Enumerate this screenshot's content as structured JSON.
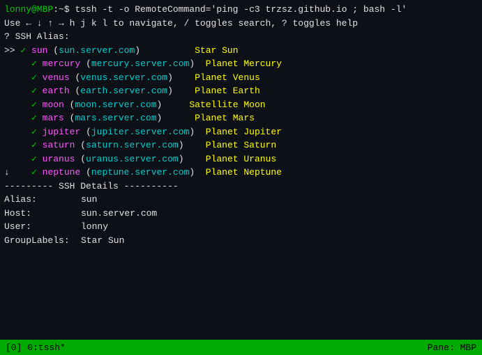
{
  "terminal": {
    "prompt": "lonny@MBP:~$ tssh -t -o RemoteCommand='ping -c3 trzsz.github.io ; bash -l'",
    "nav_hint": "Use ← ↓ ↑ → h j k l to navigate, / toggles search, ? toggles help",
    "ssh_alias_label": "? SSH Alias:",
    "entries": [
      {
        "selected": true,
        "arrow": ">>",
        "check": "✓",
        "alias": "sun",
        "host": "sun.server.com",
        "label": "Star Sun",
        "indent": 0,
        "is_arrow": true
      },
      {
        "selected": false,
        "arrow": "",
        "check": "✓",
        "alias": "mercury",
        "host": "mercury.server.com",
        "label": "Planet Mercury",
        "indent": 1,
        "is_arrow": false
      },
      {
        "selected": false,
        "arrow": "",
        "check": "✓",
        "alias": "venus",
        "host": "venus.server.com",
        "label": "Planet Venus",
        "indent": 1,
        "is_arrow": false
      },
      {
        "selected": false,
        "arrow": "",
        "check": "✓",
        "alias": "earth",
        "host": "earth.server.com",
        "label": "Planet Earth",
        "indent": 1,
        "is_arrow": false
      },
      {
        "selected": false,
        "arrow": "",
        "check": "✓",
        "alias": "moon",
        "host": "moon.server.com",
        "label": "Satellite Moon",
        "indent": 1,
        "is_arrow": false
      },
      {
        "selected": false,
        "arrow": "",
        "check": "✓",
        "alias": "mars",
        "host": "mars.server.com",
        "label": "Planet Mars",
        "indent": 1,
        "is_arrow": false
      },
      {
        "selected": false,
        "arrow": "",
        "check": "✓",
        "alias": "jupiter",
        "host": "jupiter.server.com",
        "label": "Planet Jupiter",
        "indent": 1,
        "is_arrow": false
      },
      {
        "selected": false,
        "arrow": "",
        "check": "✓",
        "alias": "saturn",
        "host": "saturn.server.com",
        "label": "Planet Saturn",
        "indent": 1,
        "is_arrow": false
      },
      {
        "selected": false,
        "arrow": "",
        "check": "✓",
        "alias": "uranus",
        "host": "uranus.server.com",
        "label": "Planet Uranus",
        "indent": 1,
        "is_arrow": false
      },
      {
        "selected": false,
        "arrow": "",
        "check": "✓",
        "alias": "neptune",
        "host": "neptune.server.com",
        "label": "Planet Neptune",
        "indent": 1,
        "is_arrow": false,
        "down_arrow": true
      }
    ],
    "details_separator": "--------- SSH Details ----------",
    "details": {
      "alias_label": "Alias:",
      "alias_value": "sun",
      "host_label": "Host:",
      "host_value": "sun.server.com",
      "user_label": "User:",
      "user_value": "lonny",
      "group_label": "GroupLabels:",
      "group_value": "Star Sun"
    }
  },
  "statusbar": {
    "left": "[0] 0:tssh*",
    "right": "Pane: MBP"
  }
}
